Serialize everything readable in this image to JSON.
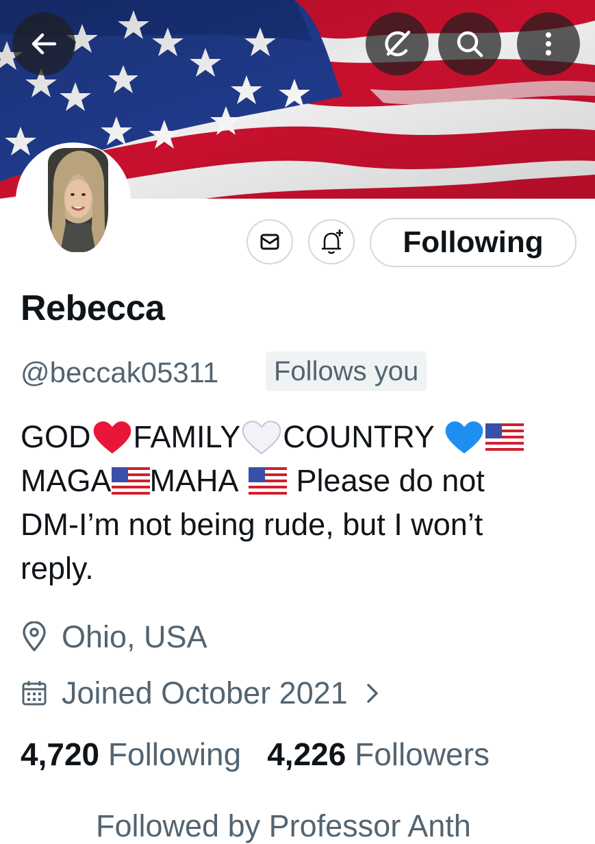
{
  "header": {
    "back_icon": "arrow-left-icon",
    "grok_icon": "grok-icon",
    "search_icon": "search-icon",
    "more_icon": "more-vertical-icon"
  },
  "banner": {
    "description_colors": {
      "blue": "#1f3a8a",
      "red": "#c8102e",
      "white": "#f2f2f2"
    }
  },
  "actions": {
    "message_icon": "envelope-icon",
    "notify_icon": "bell-plus-icon",
    "follow_label": "Following"
  },
  "profile": {
    "name": "Rebecca",
    "handle": "@beccak05311",
    "follows_you": "Follows you",
    "bio": {
      "line1": [
        "GOD",
        "FAMILY",
        "COUNTRY"
      ],
      "line2": [
        "MAGA",
        "MAHA",
        "Please do not"
      ],
      "line3": "DM-I’m not being rude, but I won’t",
      "line4": "reply."
    },
    "location": "Ohio, USA",
    "joined": "Joined October 2021",
    "following_count": "4,720",
    "following_label": "Following",
    "followers_count": "4,226",
    "followers_label": "Followers",
    "followed_by_partial": "Followed by Professor Anth"
  },
  "colors": {
    "text": "#0f1419",
    "secondary": "#536471",
    "border": "#cfd9de",
    "badge_bg": "#eff3f4"
  }
}
